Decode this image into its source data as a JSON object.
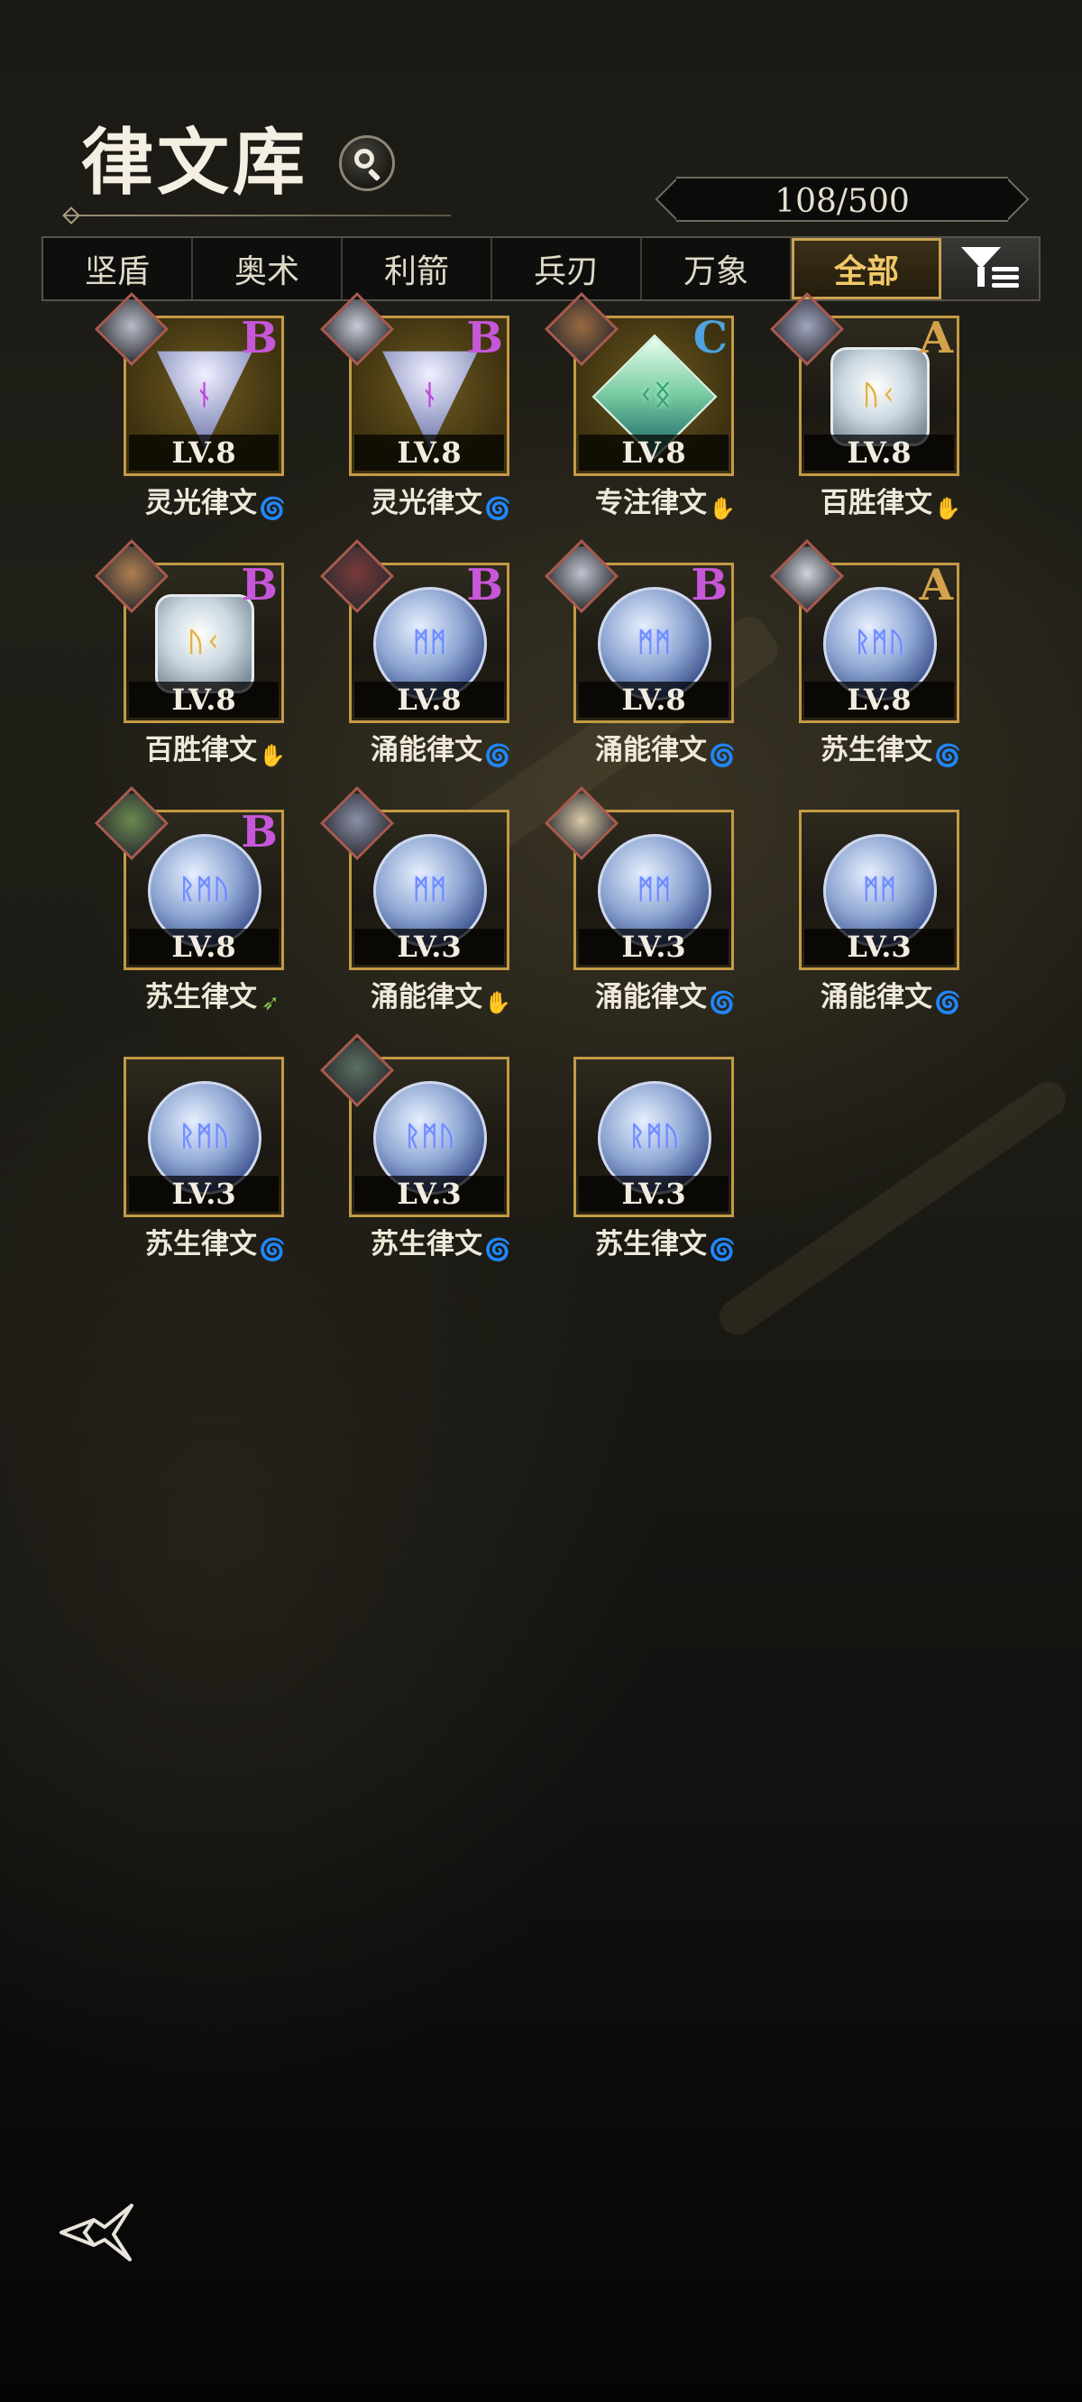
{
  "header": {
    "title": "律文库",
    "count": "108/500"
  },
  "tabs": [
    {
      "label": "坚盾",
      "active": false
    },
    {
      "label": "奥术",
      "active": false
    },
    {
      "label": "利箭",
      "active": false
    },
    {
      "label": "兵刃",
      "active": false
    },
    {
      "label": "万象",
      "active": false
    },
    {
      "label": "全部",
      "active": true
    }
  ],
  "colors": {
    "grade_A": "#d4a24a",
    "grade_B": "#c657d8",
    "grade_C": "#4ea3e0",
    "element_water": "#3d8fe6",
    "element_fire": "#e0584a",
    "element_wind": "#7ec24a"
  },
  "runes": [
    {
      "name": "灵光律文",
      "level": "LV.8",
      "grade": "B",
      "shape": "tri",
      "glyph": "ᚾ",
      "rune_color": "purple",
      "element": "water-icon",
      "avatar": true,
      "avatar_color": "#b8bcc8"
    },
    {
      "name": "灵光律文",
      "level": "LV.8",
      "grade": "B",
      "shape": "tri",
      "glyph": "ᚾ",
      "rune_color": "purple",
      "element": "water-icon",
      "avatar": true,
      "avatar_color": "#c8ccd8"
    },
    {
      "name": "专注律文",
      "level": "LV.8",
      "grade": "C",
      "shape": "diamond",
      "glyph": "ᚲᛝ",
      "rune_color": "green",
      "element": "fire-icon",
      "avatar": true,
      "avatar_color": "#9a6a40"
    },
    {
      "name": "百胜律文",
      "level": "LV.8",
      "grade": "A",
      "shape": "square",
      "glyph": "ᚢᚲ",
      "rune_color": "gold",
      "element": "fire-icon",
      "avatar": true,
      "avatar_color": "#a0a6c0"
    },
    {
      "name": "百胜律文",
      "level": "LV.8",
      "grade": "B",
      "shape": "square",
      "glyph": "ᚢᚲ",
      "rune_color": "gold",
      "element": "fire-icon",
      "avatar": true,
      "avatar_color": "#b08050"
    },
    {
      "name": "涌能律文",
      "level": "LV.8",
      "grade": "B",
      "shape": "round",
      "glyph": "ᛗᛗ",
      "rune_color": "blue",
      "element": "water-icon",
      "avatar": true,
      "avatar_color": "#7a3a3a"
    },
    {
      "name": "涌能律文",
      "level": "LV.8",
      "grade": "B",
      "shape": "round",
      "glyph": "ᛗᛗ",
      "rune_color": "blue",
      "element": "water-icon",
      "avatar": true,
      "avatar_color": "#c0c4d0"
    },
    {
      "name": "苏生律文",
      "level": "LV.8",
      "grade": "A",
      "shape": "round",
      "glyph": "ᚱᛗᚢ",
      "rune_color": "blue",
      "element": "water-icon",
      "avatar": true,
      "avatar_color": "#d0d4dc"
    },
    {
      "name": "苏生律文",
      "level": "LV.8",
      "grade": "B",
      "shape": "round",
      "glyph": "ᚱᛗᚢ",
      "rune_color": "blue",
      "element": "wind-icon",
      "avatar": true,
      "avatar_color": "#6a8a50"
    },
    {
      "name": "涌能律文",
      "level": "LV.3",
      "grade": "",
      "shape": "round",
      "glyph": "ᛗᛗ",
      "rune_color": "blue",
      "element": "fire-icon",
      "avatar": true,
      "avatar_color": "#8a90a8"
    },
    {
      "name": "涌能律文",
      "level": "LV.3",
      "grade": "",
      "shape": "round",
      "glyph": "ᛗᛗ",
      "rune_color": "blue",
      "element": "water-icon",
      "avatar": true,
      "avatar_color": "#d8c8a8"
    },
    {
      "name": "涌能律文",
      "level": "LV.3",
      "grade": "",
      "shape": "round",
      "glyph": "ᛗᛗ",
      "rune_color": "blue",
      "element": "water-icon",
      "avatar": false,
      "avatar_color": ""
    },
    {
      "name": "苏生律文",
      "level": "LV.3",
      "grade": "",
      "shape": "round",
      "glyph": "ᚱᛗᚢ",
      "rune_color": "blue",
      "element": "water-icon",
      "avatar": false,
      "avatar_color": ""
    },
    {
      "name": "苏生律文",
      "level": "LV.3",
      "grade": "",
      "shape": "round",
      "glyph": "ᚱᛗᚢ",
      "rune_color": "blue",
      "element": "water-icon",
      "avatar": true,
      "avatar_color": "#5a7060"
    },
    {
      "name": "苏生律文",
      "level": "LV.3",
      "grade": "",
      "shape": "round",
      "glyph": "ᚱᛗᚢ",
      "rune_color": "blue",
      "element": "water-icon",
      "avatar": false,
      "avatar_color": ""
    }
  ]
}
